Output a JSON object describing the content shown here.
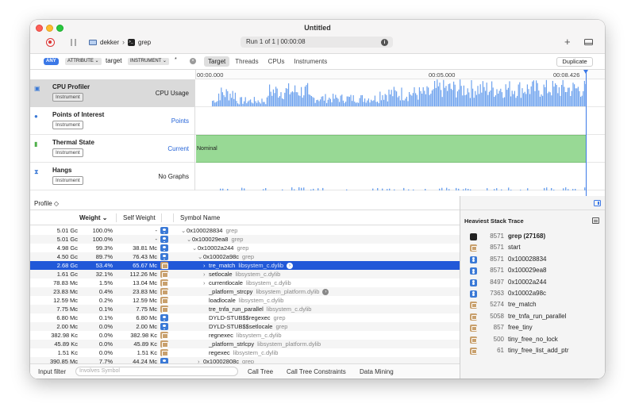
{
  "window": {
    "title": "Untitled"
  },
  "toolbar": {
    "device": "dekker",
    "process": "grep",
    "run_status": "Run 1 of 1  |  00:00:08",
    "plus": "+"
  },
  "filter": {
    "any": "ANY",
    "attribute": "ATTRIBUTE ⌄",
    "target_word": "target",
    "instrument": "INSTRUMENT ⌄",
    "value": "*",
    "scope_tabs": [
      "Target",
      "Threads",
      "CPUs",
      "Instruments"
    ],
    "duplicate": "Duplicate"
  },
  "ruler": {
    "t0": "00:00.000",
    "t1": "00:05.000",
    "t2": "00:08.426"
  },
  "tracks": [
    {
      "name": "CPU Profiler",
      "badge": "Instrument",
      "right": "CPU Usage"
    },
    {
      "name": "Points of Interest",
      "badge": "Instrument",
      "right": "Points"
    },
    {
      "name": "Thermal State",
      "badge": "Instrument",
      "right": "Current",
      "lane": "Nominal"
    },
    {
      "name": "Hangs",
      "badge": "Instrument",
      "right": "No Graphs"
    }
  ],
  "detail": {
    "profile": "Profile ◇",
    "col_weight": "Weight ⌄",
    "col_self": "Self Weight",
    "col_symbol": "Symbol Name",
    "rows": [
      {
        "weight": "5.01 Gc",
        "pct": "100.0%",
        "self": "-",
        "icon": "user",
        "indent": 0,
        "disc": "⌄",
        "name": "0x100028834",
        "lib": "grep"
      },
      {
        "weight": "5.01 Gc",
        "pct": "100.0%",
        "self": "-",
        "icon": "user",
        "indent": 1,
        "disc": "⌄",
        "name": "0x100029ea8",
        "lib": "grep"
      },
      {
        "weight": "4.98 Gc",
        "pct": "99.3%",
        "self": "38.81 Mc",
        "icon": "user",
        "indent": 2,
        "disc": "⌄",
        "name": "0x10002a244",
        "lib": "grep"
      },
      {
        "weight": "4.50 Gc",
        "pct": "89.7%",
        "self": "76.43 Mc",
        "icon": "user",
        "indent": 3,
        "disc": "⌄",
        "name": "0x10002a98c",
        "lib": "grep"
      },
      {
        "weight": "2.68 Gc",
        "pct": "53.4%",
        "self": "65.67 Mc",
        "icon": "lib",
        "indent": 4,
        "disc": "›",
        "name": "tre_match",
        "lib": "libsystem_c.dylib",
        "go": true,
        "selected": true
      },
      {
        "weight": "1.61 Gc",
        "pct": "32.1%",
        "self": "112.26 Mc",
        "icon": "lib",
        "indent": 4,
        "disc": "›",
        "name": "setlocale",
        "lib": "libsystem_c.dylib"
      },
      {
        "weight": "78.83 Mc",
        "pct": "1.5%",
        "self": "13.04 Mc",
        "icon": "lib",
        "indent": 4,
        "disc": "›",
        "name": "currentlocale",
        "lib": "libsystem_c.dylib"
      },
      {
        "weight": "23.83 Mc",
        "pct": "0.4%",
        "self": "23.83 Mc",
        "icon": "lib",
        "indent": 4,
        "disc": "",
        "name": "_platform_strcpy",
        "lib": "libsystem_platform.dylib",
        "go": true
      },
      {
        "weight": "12.59 Mc",
        "pct": "0.2%",
        "self": "12.59 Mc",
        "icon": "lib",
        "indent": 4,
        "disc": "",
        "name": "loadlocale",
        "lib": "libsystem_c.dylib"
      },
      {
        "weight": "7.75 Mc",
        "pct": "0.1%",
        "self": "7.75 Mc",
        "icon": "lib",
        "indent": 4,
        "disc": "",
        "name": "tre_tnfa_run_parallel",
        "lib": "libsystem_c.dylib"
      },
      {
        "weight": "6.80 Mc",
        "pct": "0.1%",
        "self": "6.80 Mc",
        "icon": "user",
        "indent": 4,
        "disc": "",
        "name": "DYLD-STUB$$regexec",
        "lib": "grep"
      },
      {
        "weight": "2.00 Mc",
        "pct": "0.0%",
        "self": "2.00 Mc",
        "icon": "user",
        "indent": 4,
        "disc": "",
        "name": "DYLD-STUB$$setlocale",
        "lib": "grep"
      },
      {
        "weight": "382.98 Kc",
        "pct": "0.0%",
        "self": "382.98 Kc",
        "icon": "lib",
        "indent": 4,
        "disc": "",
        "name": "regnexec",
        "lib": "libsystem_c.dylib"
      },
      {
        "weight": "45.89 Kc",
        "pct": "0.0%",
        "self": "45.89 Kc",
        "icon": "lib",
        "indent": 4,
        "disc": "",
        "name": "_platform_strlcpy",
        "lib": "libsystem_platform.dylib"
      },
      {
        "weight": "1.51 Kc",
        "pct": "0.0%",
        "self": "1.51 Kc",
        "icon": "lib",
        "indent": 4,
        "disc": "",
        "name": "regexec",
        "lib": "libsystem_c.dylib"
      },
      {
        "weight": "390.85 Mc",
        "pct": "7.7%",
        "self": "44.24 Mc",
        "icon": "user",
        "indent": 3,
        "disc": "›",
        "name": "0x10002808c",
        "lib": "grep"
      }
    ],
    "input_filter": "Input filter",
    "involves_placeholder": "Involves Symbol",
    "bottom_tabs": [
      "Call Tree",
      "Call Tree Constraints",
      "Data Mining"
    ]
  },
  "inspector": {
    "title": "Heaviest Stack Trace",
    "stack": [
      {
        "count": "8571",
        "name": "grep (27168)",
        "icon": "term",
        "bold": true
      },
      {
        "count": "8571",
        "name": "start",
        "icon": "lib"
      },
      {
        "count": "8571",
        "name": "0x100028834",
        "icon": "user"
      },
      {
        "count": "8571",
        "name": "0x100029ea8",
        "icon": "user"
      },
      {
        "count": "8497",
        "name": "0x10002a244",
        "icon": "user"
      },
      {
        "count": "7363",
        "name": "0x10002a98c",
        "icon": "user"
      },
      {
        "count": "5274",
        "name": "tre_match",
        "icon": "lib"
      },
      {
        "count": "5058",
        "name": "tre_tnfa_run_parallel",
        "icon": "lib"
      },
      {
        "count": "857",
        "name": "free_tiny",
        "icon": "lib"
      },
      {
        "count": "500",
        "name": "tiny_free_no_lock",
        "icon": "lib"
      },
      {
        "count": "61",
        "name": "tiny_free_list_add_ptr",
        "icon": "lib"
      }
    ]
  },
  "colors": {
    "accent": "#3b78e7",
    "selection": "#2158d8",
    "cpu_bars": "#6fa3ee",
    "thermal": "#98d995"
  }
}
